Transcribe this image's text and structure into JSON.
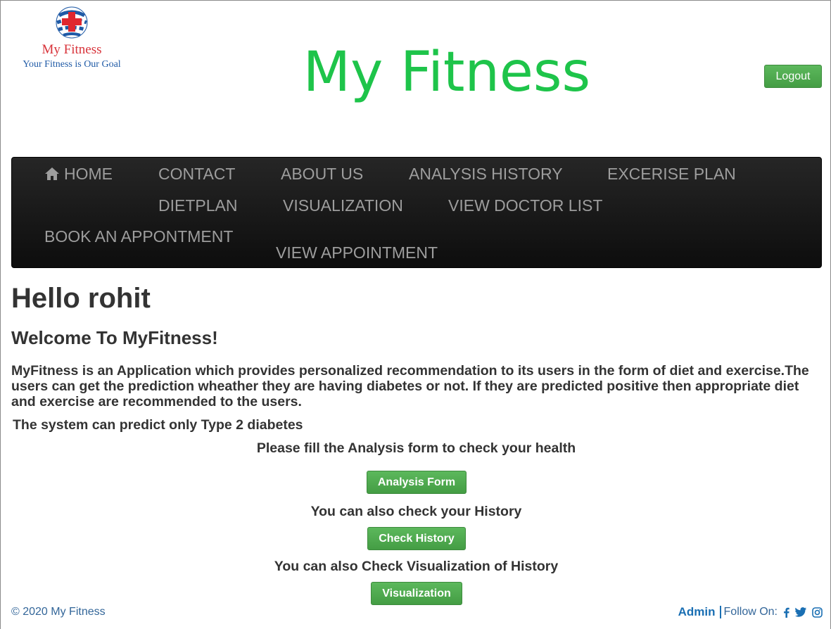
{
  "header": {
    "logo_name": "My Fitness",
    "logo_tagline": "Your Fitness is Our Goal",
    "site_title": "My Fitness",
    "logout_label": "Logout"
  },
  "nav": {
    "items": [
      {
        "label": "HOME",
        "icon": "home-icon"
      },
      {
        "label": "CONTACT"
      },
      {
        "label": "ABOUT US"
      },
      {
        "label": "ANALYSIS HISTORY"
      },
      {
        "label": "EXCERISE PLAN"
      },
      {
        "label": "DIETPLAN"
      },
      {
        "label": "VISUALIZATION"
      },
      {
        "label": "VIEW DOCTOR LIST"
      },
      {
        "label": "BOOK AN APPONTMENT"
      },
      {
        "label": "VIEW APPOINTMENT"
      }
    ]
  },
  "main": {
    "greeting": "Hello rohit",
    "welcome": "Welcome To MyFitness!",
    "intro": "MyFitness is an Application which provides personalized recommendation to its users in the form of diet and exercise.The users can get the prediction wheather they are having diabetes or not. If they are predicted positive then appropriate diet and exercise are recommended to the users.",
    "prediction_note": "The system can predict only Type 2 diabetes",
    "analysis_prompt": "Please fill the Analysis form to check your health",
    "analysis_button": "Analysis Form",
    "history_prompt": "You can also check your History",
    "history_button": "Check History",
    "visualization_prompt": "You can also Check Visualization of History",
    "visualization_button": "Visualization"
  },
  "footer": {
    "copyright": "© 2020 My Fitness",
    "admin_link": "Admin",
    "follow_label": "Follow On:",
    "social_icons": [
      "facebook-icon",
      "twitter-icon",
      "instagram-icon"
    ]
  },
  "colors": {
    "title_green": "#1ec44a",
    "button_green": "#5cb85c",
    "navbar_bg": "#1a1a1a",
    "nav_text": "#9d9d9d",
    "link_blue": "#1a6fb3"
  }
}
